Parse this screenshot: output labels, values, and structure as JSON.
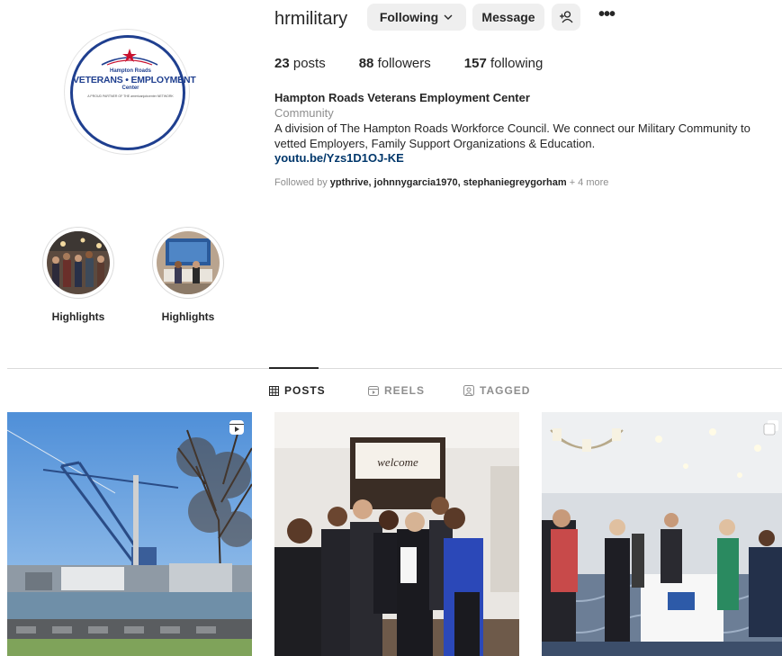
{
  "profile": {
    "username": "hrmilitary",
    "following_btn": "Following",
    "message_btn": "Message",
    "avatar_logo": {
      "top_text": "Hampton Roads",
      "big_text": "VETERANS • EMPLOYMENT",
      "small_text": "Center",
      "fine_text": "A PROUD PARTNER OF THE americanjobcenter NETWORK"
    }
  },
  "stats": {
    "posts_count": "23",
    "posts_label": "posts",
    "followers_count": "88",
    "followers_label": "followers",
    "following_count": "157",
    "following_label": "following"
  },
  "bio": {
    "name": "Hampton Roads Veterans Employment Center",
    "category": "Community",
    "text": "A division of The Hampton Roads Workforce Council. We connect our Military Community to vetted Employers, Family Support Organizations & Education.",
    "link": "youtu.be/Yzs1D1OJ-KE",
    "followed_prefix": "Followed by",
    "followed_names": "ypthrive, johnnygarcia1970, stephaniegreygorham",
    "followed_more": "+ 4 more"
  },
  "highlights": [
    {
      "label": "Highlights"
    },
    {
      "label": "Highlights"
    }
  ],
  "tabs": {
    "posts": "POSTS",
    "reels": "REELS",
    "tagged": "TAGGED"
  },
  "posts_grid": {
    "post1_badge": "reel-icon",
    "post2_sign": "welcome",
    "post3_badge": "carousel-icon"
  },
  "colors": {
    "link": "#00376b",
    "brand_navy": "#1f3f8f",
    "button_bg": "#efefef"
  }
}
